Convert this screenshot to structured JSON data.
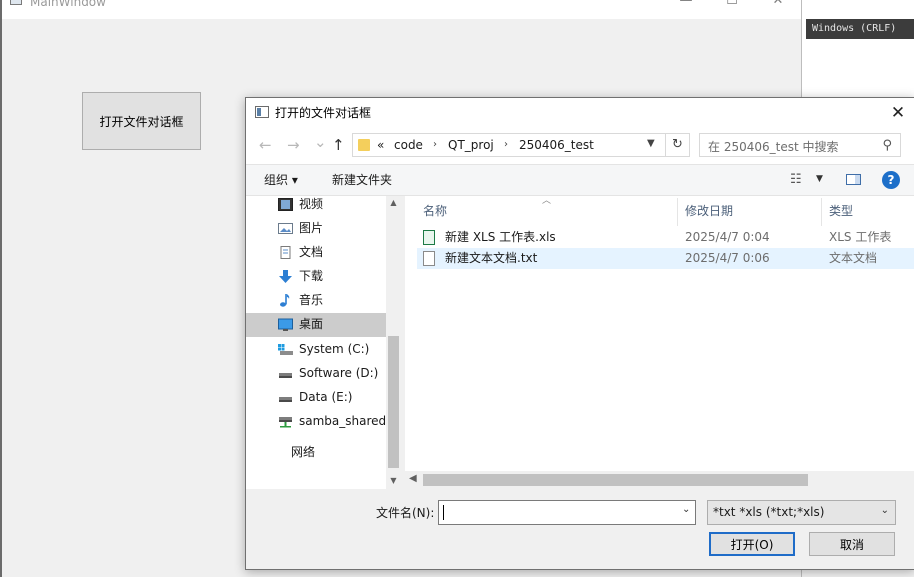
{
  "background": {
    "status_text": "Windows (CRLF)"
  },
  "main_window": {
    "title": "MainWindow",
    "open_dialog_button": "打开文件对话框",
    "caption_minimize": "—",
    "caption_maximize": "☐",
    "caption_close": "✕"
  },
  "dialog": {
    "title": "打开的文件对话框",
    "close_glyph": "✕",
    "nav": {
      "back": "←",
      "forward": "→",
      "recent": "⌄",
      "up": "↑",
      "prefix": "«",
      "breadcrumbs": [
        "code",
        "QT_proj",
        "250406_test"
      ],
      "separator": "›",
      "refresh": "↻",
      "search_placeholder": "在 250406_test 中搜索"
    },
    "toolbar": {
      "organize": "组织 ▾",
      "new_folder": "新建文件夹",
      "help": "?"
    },
    "sidebar": {
      "items": [
        {
          "label": "视频",
          "icon": "video-icon"
        },
        {
          "label": "图片",
          "icon": "pictures-icon"
        },
        {
          "label": "文档",
          "icon": "documents-icon"
        },
        {
          "label": "下载",
          "icon": "download-icon"
        },
        {
          "label": "音乐",
          "icon": "music-icon"
        },
        {
          "label": "桌面",
          "icon": "desktop-icon",
          "selected": true
        },
        {
          "label": "System (C:)",
          "icon": "system-drive-icon"
        },
        {
          "label": "Software (D:)",
          "icon": "drive-icon"
        },
        {
          "label": "Data (E:)",
          "icon": "drive-icon"
        },
        {
          "label": "samba_shared",
          "icon": "network-drive-icon"
        },
        {
          "label": "网络",
          "icon": "network-icon"
        }
      ]
    },
    "columns": {
      "name": "名称",
      "modified": "修改日期",
      "type": "类型"
    },
    "files": [
      {
        "name": "新建 XLS 工作表.xls",
        "modified": "2025/4/7 0:04",
        "type": "XLS 工作表",
        "icon": "xls-file-icon"
      },
      {
        "name": "新建文本文档.txt",
        "modified": "2025/4/7 0:06",
        "type": "文本文档",
        "icon": "txt-file-icon",
        "selected": true
      }
    ],
    "filename_label": "文件名(N):",
    "filename_value": "",
    "filter_value": "*txt *xls (*txt;*xls)",
    "open_button": "打开(O)",
    "cancel_button": "取消"
  },
  "colors": {
    "accent": "#1f6cc8",
    "selection": "#e5f3ff",
    "nav_selected": "#cccccc"
  }
}
